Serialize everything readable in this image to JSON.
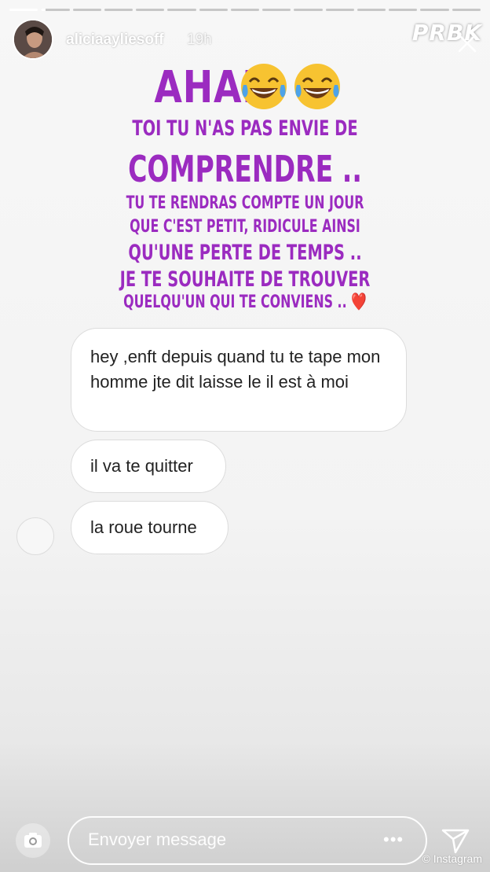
{
  "header": {
    "username": "aliciaayliesoff",
    "time": "19h",
    "watermark": "PRBK"
  },
  "progress": {
    "segments": 15,
    "current_index": 1,
    "current_fraction": 0.15
  },
  "story_text": {
    "line1": "AHAH",
    "line2": "TOI TU N'AS PAS ENVIE DE",
    "line3": "COMPRENDRE ..",
    "line4": "TU TE RENDRAS COMPTE UN JOUR",
    "line5": "QUE C'EST PETIT, RIDICULE AINSI",
    "line6": "QU'UNE PERTE DE TEMPS ..",
    "line7": "JE TE SOUHAITE DE TROUVER",
    "line8": "QUELQU'UN QUI TE CONVIENS ..",
    "emojis": "😂😂",
    "heart": "❤️",
    "color": "#9b2bc0"
  },
  "messages": [
    {
      "text": "hey ,enft depuis quand tu te tape mon homme jte dit laisse le il est à moi"
    },
    {
      "text": "il va te quitter"
    },
    {
      "text": "la roue tourne"
    }
  ],
  "footer": {
    "placeholder": "Envoyer message",
    "camera_icon": "camera-icon",
    "more_icon": "more-icon",
    "send_icon": "send-icon",
    "credit": "© Instagram"
  }
}
